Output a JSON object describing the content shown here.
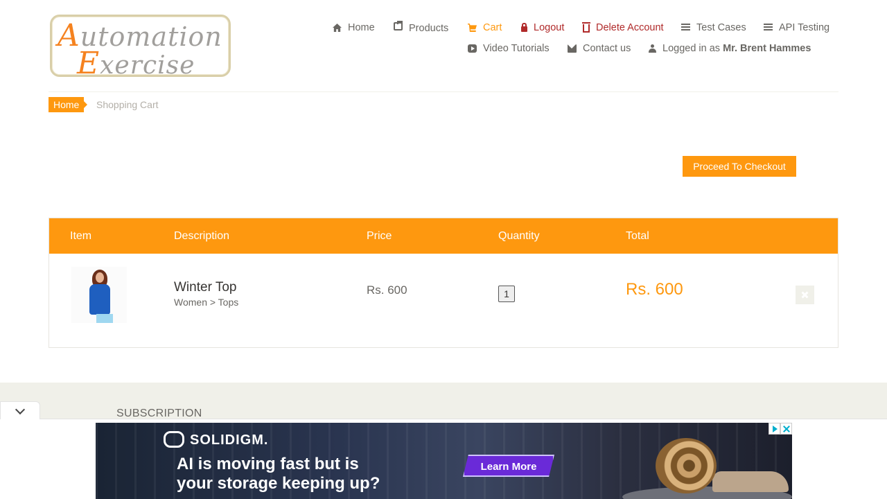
{
  "brand": {
    "logo_line1_cap": "A",
    "logo_line1_rest": "utomation",
    "logo_line2_cap": "E",
    "logo_line2_rest": "xercise"
  },
  "nav": {
    "home": "Home",
    "products": "Products",
    "cart": "Cart",
    "logout": "Logout",
    "delete_account": "Delete Account",
    "test_cases": "Test Cases",
    "api_testing": "API Testing",
    "video_tutorials": "Video Tutorials",
    "contact_us": "Contact us",
    "logged_in_prefix": "Logged in as",
    "logged_in_user": "Mr. Brent Hammes"
  },
  "breadcrumb": {
    "home": "Home",
    "current": "Shopping Cart"
  },
  "checkout_button": "Proceed To Checkout",
  "cart_table": {
    "headers": {
      "item": "Item",
      "description": "Description",
      "price": "Price",
      "quantity": "Quantity",
      "total": "Total"
    },
    "rows": [
      {
        "name": "Winter Top",
        "category": "Women > Tops",
        "price": "Rs. 600",
        "quantity": "1",
        "total": "Rs. 600"
      }
    ]
  },
  "footer": {
    "subscription_title": "SUBSCRIPTION"
  },
  "ad": {
    "brand": "SOLIDIGM.",
    "line1": "AI is moving fast but is",
    "line2": "your storage keeping up?",
    "cta": "Learn More"
  },
  "colors": {
    "accent": "#fe980f",
    "danger": "#b02a2a",
    "text": "#696763",
    "footer_bg": "#f0f0e9"
  },
  "icons": [
    "home-icon",
    "briefcase-icon",
    "cart-icon",
    "lock-icon",
    "trash-icon",
    "list-icon",
    "video-icon",
    "envelope-icon",
    "user-icon",
    "close-icon",
    "chevron-down-icon"
  ]
}
